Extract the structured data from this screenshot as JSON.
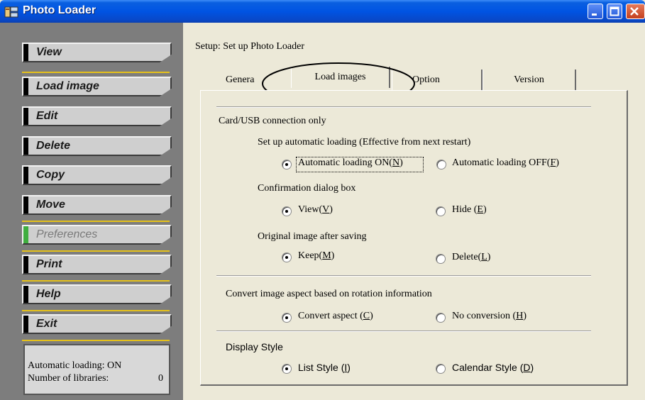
{
  "window": {
    "title": "Photo Loader"
  },
  "sidebar": {
    "items": [
      {
        "label": "View"
      },
      {
        "label": "Load image"
      },
      {
        "label": "Edit"
      },
      {
        "label": "Delete"
      },
      {
        "label": "Copy"
      },
      {
        "label": "Move"
      },
      {
        "label": "Preferences",
        "state": "active"
      },
      {
        "label": "Print"
      },
      {
        "label": "Help"
      },
      {
        "label": "Exit"
      }
    ],
    "status": {
      "auto_loading_label": "Automatic loading:",
      "auto_loading_value": "ON",
      "libraries_label": "Number of libraries:",
      "libraries_value": "0"
    }
  },
  "main": {
    "setup_title": "Setup: Set up Photo Loader",
    "tabs": [
      {
        "label": "Genera"
      },
      {
        "label": "Load images",
        "selected": true
      },
      {
        "label": "Option"
      },
      {
        "label": "Version"
      }
    ],
    "section_card_usb": "Card/USB connection only",
    "auto_loading": {
      "label": "Set up automatic loading (Effective from next restart)",
      "on": {
        "text": "Automatic loading ON(",
        "key": "N",
        "close": ")",
        "checked": true
      },
      "off": {
        "text": "Automatic loading OFF(",
        "key": "F",
        "close": ")",
        "checked": false
      }
    },
    "confirmation": {
      "label": "Confirmation dialog box",
      "view": {
        "text": "View(",
        "key": "V",
        "close": ")",
        "checked": true
      },
      "hide": {
        "text": "Hide (",
        "key": "E",
        "close": ")",
        "checked": false
      }
    },
    "original": {
      "label": "Original image after saving",
      "keep": {
        "text": "Keep(",
        "key": "M",
        "close": ")",
        "checked": true
      },
      "delete": {
        "text": "Delete(",
        "key": "L",
        "close": ")",
        "checked": false
      }
    },
    "convert": {
      "label": "Convert image aspect based on rotation information",
      "convert": {
        "text": "Convert aspect (",
        "key": "C",
        "close": ")",
        "checked": true
      },
      "none": {
        "text": "No conversion (",
        "key": "H",
        "close": ")",
        "checked": false
      }
    },
    "display": {
      "label": "Display Style",
      "list": {
        "text": "List Style (",
        "key": "I",
        "close": ")",
        "checked": true
      },
      "calendar": {
        "text": "Calendar Style (",
        "key": "D",
        "close": ")",
        "checked": false
      }
    }
  },
  "colors": {
    "titlebar": "#0054e3",
    "sidebar_bg": "#7d7d7d",
    "dialog_bg": "#ece9d8",
    "separator": "#e6c21a",
    "active_marker": "#3fae3f"
  }
}
